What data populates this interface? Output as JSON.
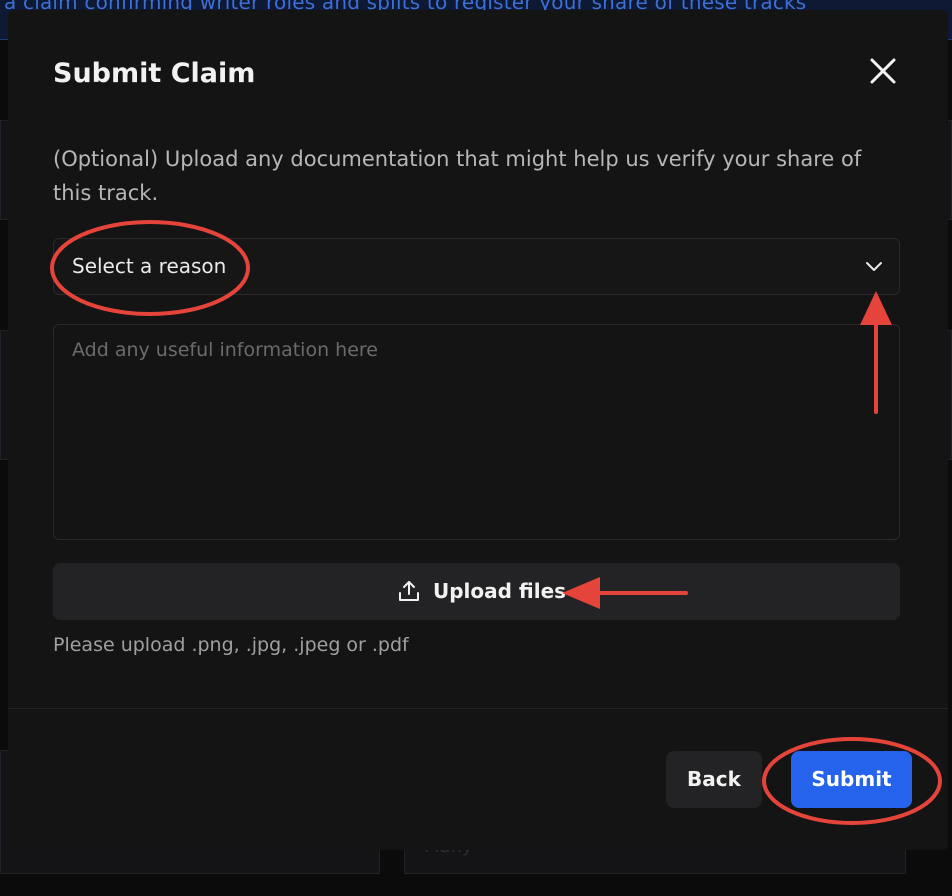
{
  "background": {
    "banner_text": "a claim confirming writer roles and splits to register your share of these tracks",
    "bottom_text": "Many"
  },
  "modal": {
    "title": "Submit Claim",
    "description": "(Optional) Upload any documentation that might help us verify your share of this track.",
    "reason_select": {
      "value": "Select a reason"
    },
    "info": {
      "placeholder": "Add any useful information here"
    },
    "upload": {
      "label": "Upload files"
    },
    "file_hint": "Please upload .png, .jpg, .jpeg or .pdf",
    "back_label": "Back",
    "submit_label": "Submit"
  },
  "icons": {
    "close": "close-icon",
    "chevron": "chevron-down-icon",
    "upload": "upload-icon"
  },
  "colors": {
    "primary": "#2563ec",
    "annotation": "#e5443a",
    "modal_bg": "#141414"
  }
}
